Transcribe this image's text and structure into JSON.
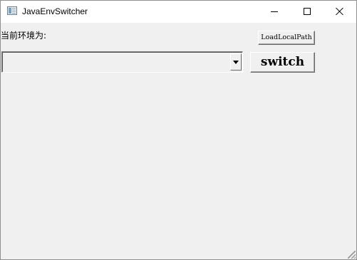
{
  "window": {
    "title": "JavaEnvSwitcher",
    "app_icon": "window-app-icon"
  },
  "caption_buttons": {
    "minimize_icon": "minimize-icon",
    "maximize_icon": "maximize-icon",
    "close_icon": "close-icon"
  },
  "main": {
    "current_env_label": "当前环境为:",
    "load_local_path_label": "LoadLocalPath",
    "env_select_value": "",
    "switch_label": "switch"
  }
}
